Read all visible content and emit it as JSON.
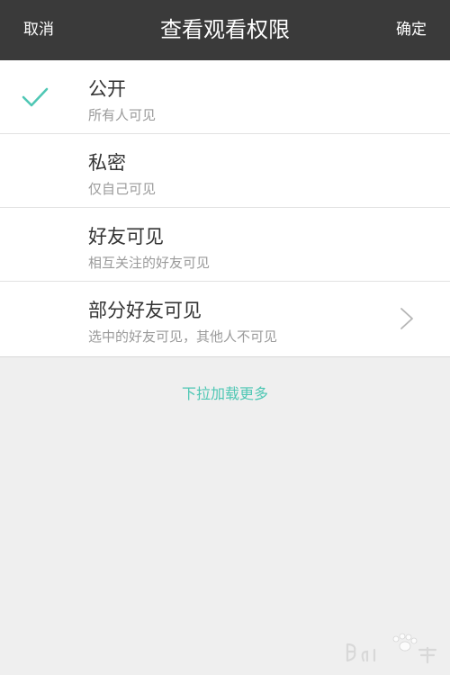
{
  "header": {
    "cancel_label": "取消",
    "title": "查看观看权限",
    "confirm_label": "确定"
  },
  "options": [
    {
      "label": "公开",
      "description": "所有人可见",
      "selected": true
    },
    {
      "label": "私密",
      "description": "仅自己可见",
      "selected": false
    },
    {
      "label": "好友可见",
      "description": "相互关注的好友可见",
      "selected": false
    },
    {
      "label": "部分好友可见",
      "description": "选中的好友可见，其他人不可见",
      "selected": false,
      "has_chevron": true
    }
  ],
  "load_more_label": "下拉加载更多",
  "colors": {
    "header_bg": "#3a3a3a",
    "accent": "#4fc7b4",
    "page_bg": "#efefef"
  },
  "icons": {
    "selected": "check-icon",
    "navigate": "chevron-right-icon"
  }
}
